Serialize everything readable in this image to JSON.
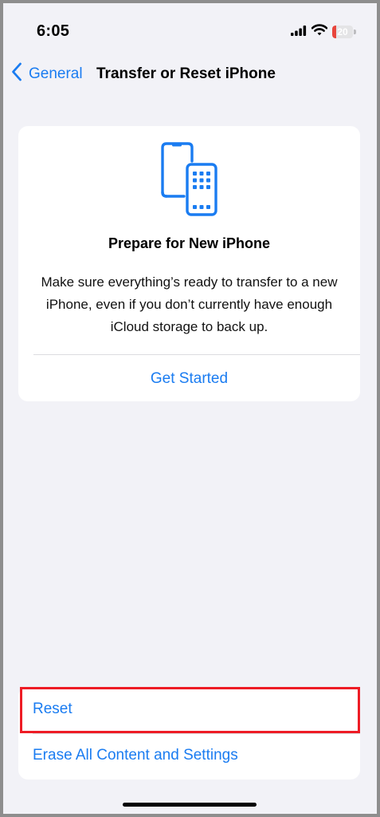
{
  "status_bar": {
    "time": "6:05",
    "battery_level": "20",
    "battery_fraction": 0.2,
    "icons": [
      "signal-icon",
      "wifi-icon",
      "battery-icon"
    ]
  },
  "nav": {
    "back_label": "General",
    "title": "Transfer or Reset iPhone"
  },
  "prepare_card": {
    "icon": "phones-transfer-icon",
    "title": "Prepare for New iPhone",
    "body": "Make sure everything’s ready to transfer to a new iPhone, even if you don’t currently have enough iCloud storage to back up.",
    "action_label": "Get Started"
  },
  "reset_group": {
    "reset_label": "Reset",
    "erase_label": "Erase All Content and Settings"
  },
  "colors": {
    "accent": "#1a7cf1",
    "background": "#f2f2f7",
    "highlight": "#ee1c25",
    "battery_low": "#e8453c"
  }
}
